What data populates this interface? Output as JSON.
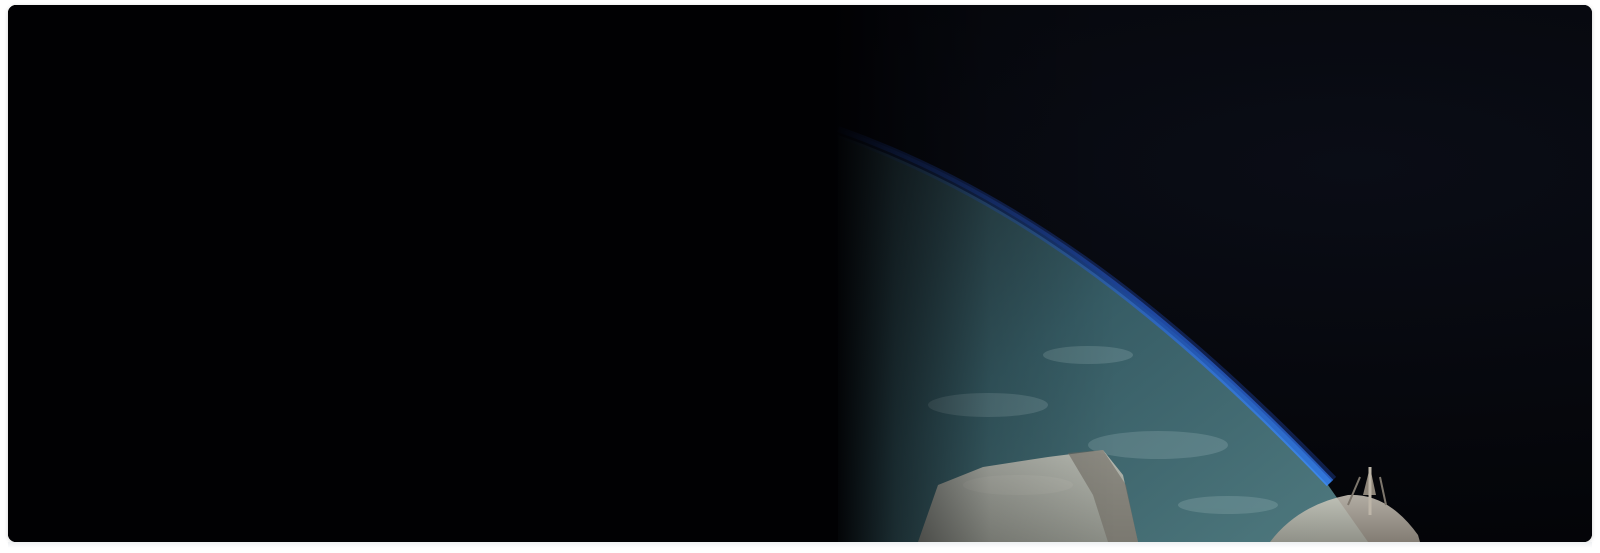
{
  "hero": {
    "image_subject": "earth-horizon-from-orbit-with-spacecraft",
    "colors": {
      "space": "#020204",
      "atmosphere_glow": "#2f6fd6",
      "earth_surface": "#4f7f86",
      "spacecraft": "#cfc8bd"
    }
  }
}
